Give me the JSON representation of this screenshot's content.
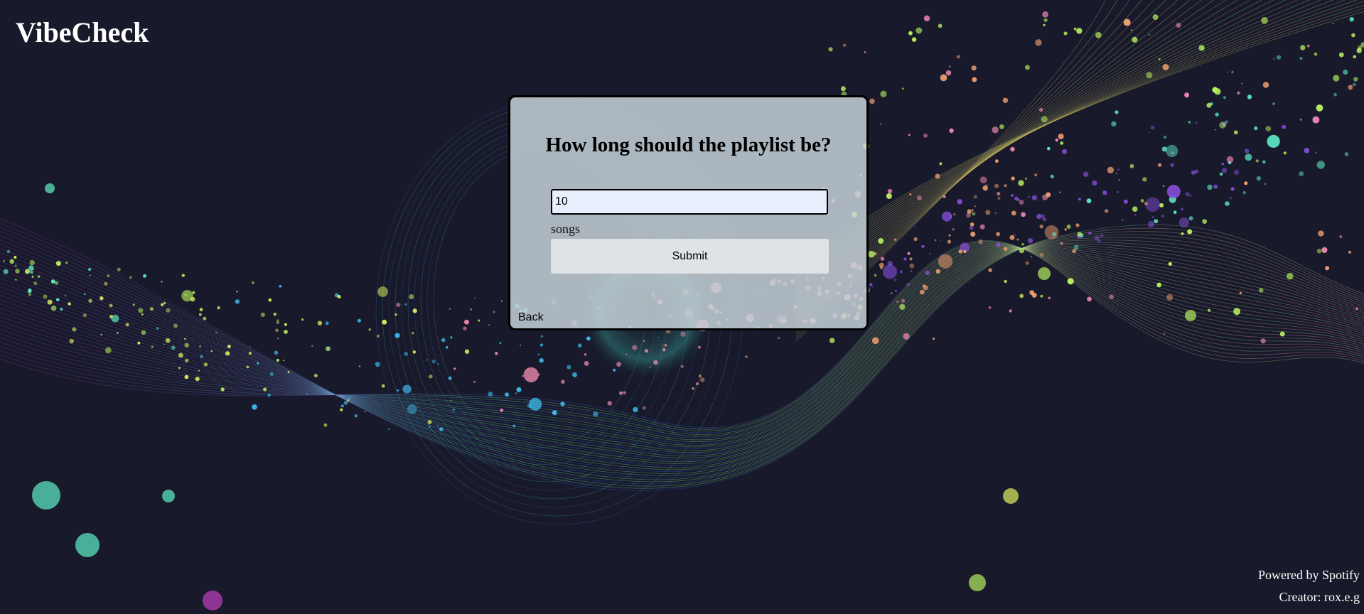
{
  "app": {
    "title": "VibeCheck"
  },
  "form": {
    "question": "How long should the playlist be?",
    "length_value": "10",
    "unit_label": "songs",
    "submit_label": "Submit",
    "back_label": "Back"
  },
  "footer": {
    "powered_by": "Powered by Spotify",
    "creator": "Creator: rox.e.g"
  },
  "colors": {
    "background": "#181a2b",
    "card": "#c8d4da",
    "input_fill": "#e8f0fe",
    "accent_green": "#b8f060",
    "accent_cyan": "#60f0c8",
    "accent_purple": "#7a2ac0",
    "accent_pink": "#f08ab0"
  },
  "icons": [
    "background-particle-artwork"
  ]
}
